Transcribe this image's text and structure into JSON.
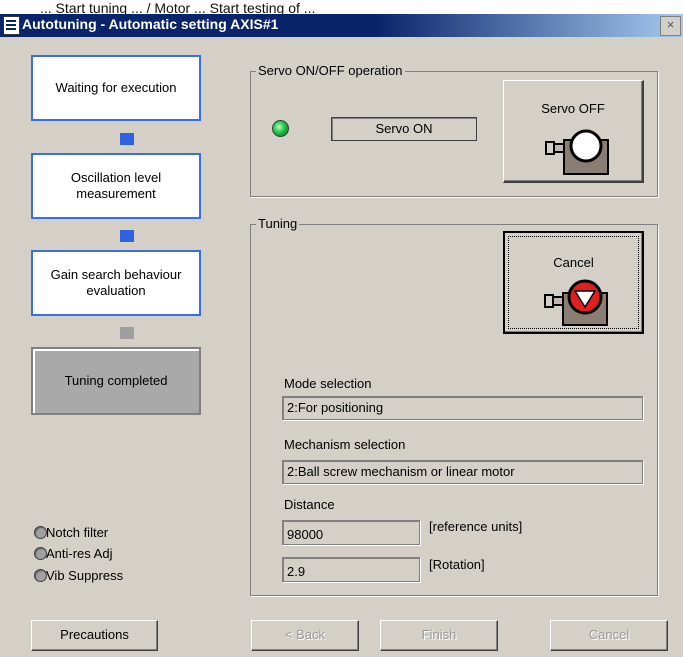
{
  "window": {
    "top_partial_text": "...  Start tuning ... / Motor ... Start testing of ... ",
    "title": "Autotuning - Automatic setting AXIS#1",
    "close_glyph": "×"
  },
  "steps": [
    {
      "label": "Waiting for execution",
      "state": "active"
    },
    {
      "label": "Oscillation level measurement",
      "state": "active"
    },
    {
      "label": "Gain search behaviour evaluation",
      "state": "active"
    },
    {
      "label": "Tuning completed",
      "state": "done"
    }
  ],
  "indicators": [
    {
      "label": "Notch filter"
    },
    {
      "label": "Anti-res Adj"
    },
    {
      "label": "Vib Suppress"
    }
  ],
  "servo": {
    "group_label": "Servo ON/OFF operation",
    "status": "Servo ON",
    "led_color": "#22c04a",
    "button_label": "Servo OFF",
    "button_icon": "servo-motor-icon"
  },
  "tuning": {
    "group_label": "Tuning",
    "cancel_label": "Cancel",
    "cancel_icon": "stop-motor-icon",
    "mode_label": "Mode selection",
    "mode_value": "2:For positioning",
    "mechanism_label": "Mechanism selection",
    "mechanism_value": "2:Ball screw mechanism or linear motor",
    "distance_label": "Distance",
    "distance_value": "98000",
    "distance_unit": "[reference units]",
    "rotation_value": "2.9",
    "rotation_unit": "[Rotation]"
  },
  "footer": {
    "precautions": "Precautions",
    "back": "< Back",
    "finish": "Finish",
    "cancel": "Cancel"
  },
  "colors": {
    "title_bar": "#0a246a",
    "step_border": "#3a6de8",
    "connector": "#2f62e0",
    "stop_red": "#e02020"
  }
}
